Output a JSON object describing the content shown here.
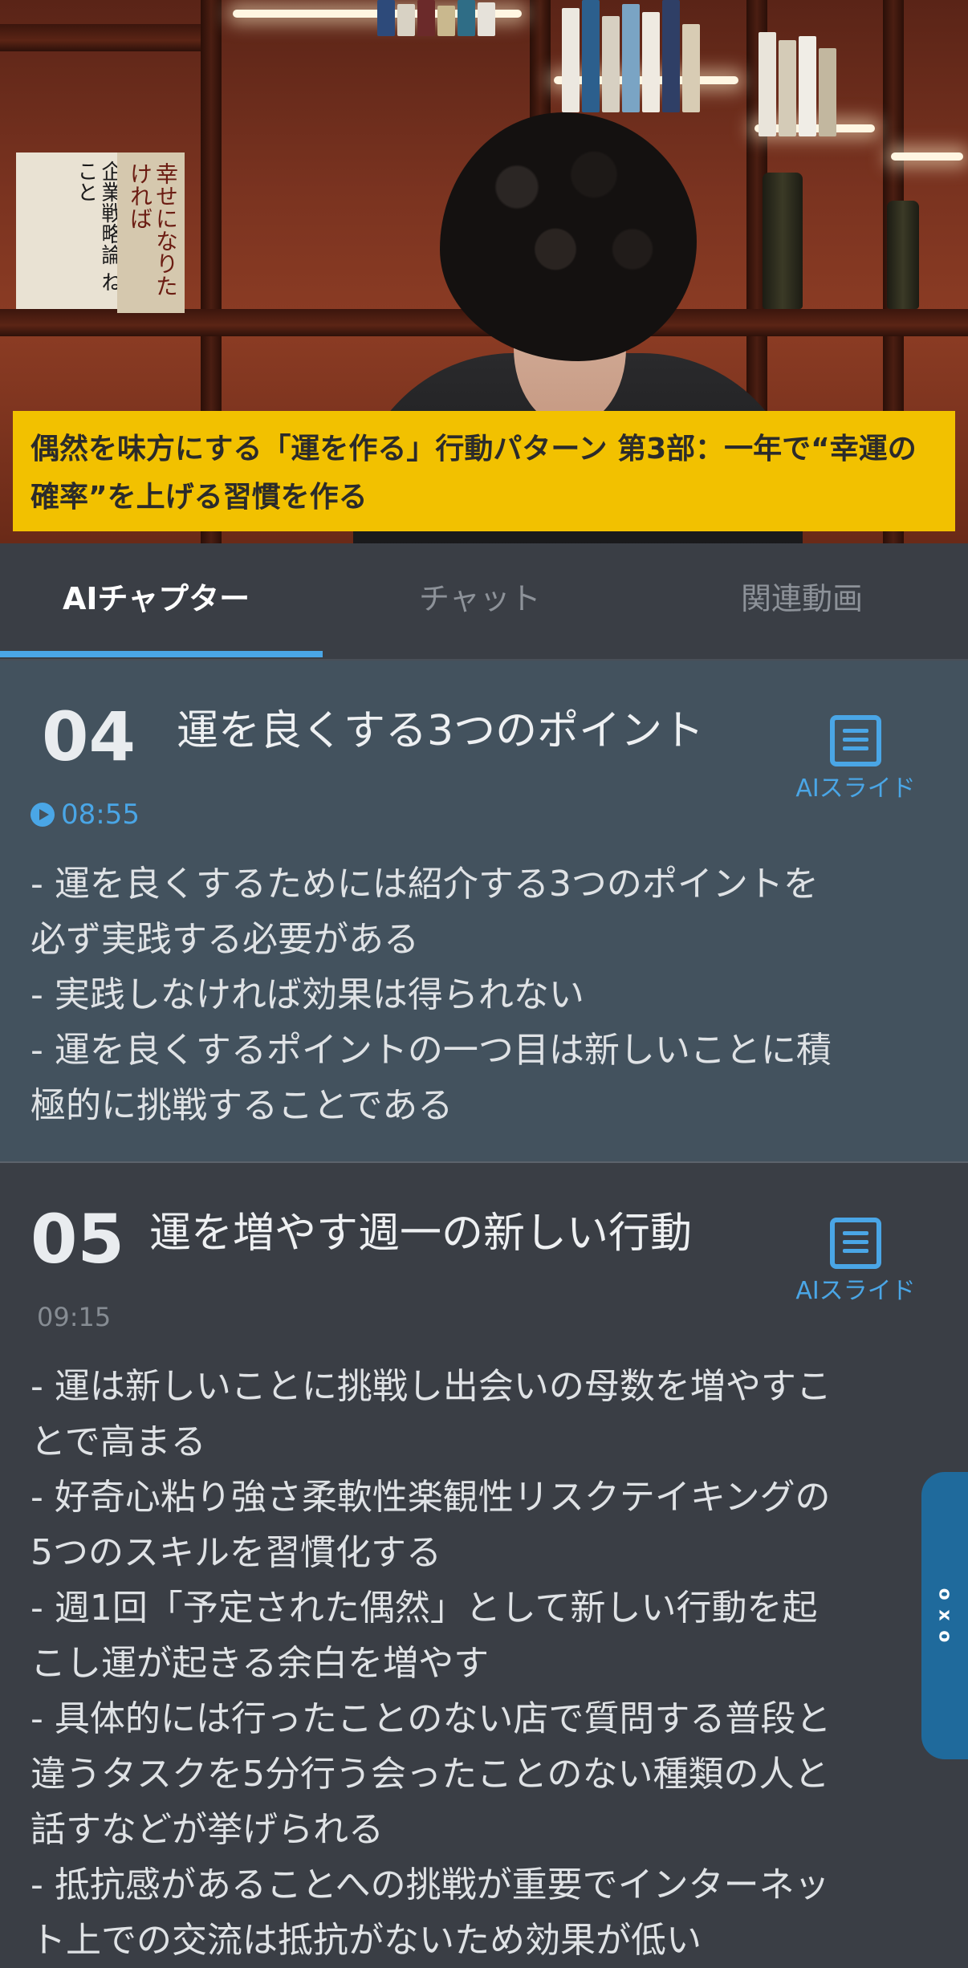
{
  "video": {
    "title": "偶然を味方にする「運を作る」行動パターン 第3部：一年で“幸運の確率”を上げる習慣を作る",
    "book_cover_text": "企業戦略論 ねこと",
    "book_cover2_text": "幸せになりたければ"
  },
  "tabs": [
    {
      "label": "AIチャプター",
      "active": true
    },
    {
      "label": "チャット",
      "active": false
    },
    {
      "label": "関連動画",
      "active": false
    }
  ],
  "chapters": [
    {
      "number": "04",
      "title": "運を良くする3つのポイント",
      "time": "08:55",
      "slide_label": "AIスライド",
      "lines": [
        "- 運を良くするためには紹介する3つのポイントを",
        "必ず実践する必要がある",
        "- 実践しなければ効果は得られない",
        "- 運を良くするポイントの一つ目は新しいことに積",
        "極的に挑戦することである"
      ]
    },
    {
      "number": "05",
      "title": "運を増やす週一の新しい行動",
      "time": "09:15",
      "slide_label": "AIスライド",
      "lines": [
        "- 運は新しいことに挑戦し出会いの母数を増やすこ",
        "とで高まる",
        "- 好奇心粘り強さ柔軟性楽観性リスクテイキングの",
        "5つのスキルを習慣化する",
        "- 週1回「予定された偶然」として新しい行動を起",
        "こし運が起きる余白を増やす",
        "- 具体的には行ったことのない店で質問する普段と",
        "違うタスクを5分行う会ったことのない種類の人と",
        "話すなどが挙げられる",
        "- 抵抗感があることへの挑戦が重要でインターネッ",
        "ト上での交流は抵抗がないため効果が低い"
      ]
    }
  ],
  "side_handle": {
    "label": "o x o"
  },
  "colors": {
    "accent": "#4aa6e6",
    "title_banner": "#f2c100",
    "active_chapter_bg": "#43525e",
    "page_bg": "#3a3e45"
  }
}
